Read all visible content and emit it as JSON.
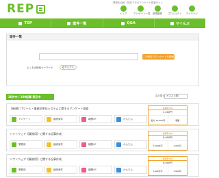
{
  "header": {
    "logo": "REP",
    "tagline": "業務を比較・検討できるアンケート調査サイト",
    "icons": [
      {
        "name": "home-icon",
        "label": "トップ"
      },
      {
        "name": "list-icon",
        "label": "アンケート一覧"
      },
      {
        "name": "pen-icon",
        "label": "新規登録"
      },
      {
        "name": "doc-icon",
        "label": "プロジェクト"
      },
      {
        "name": "user-icon",
        "label": "マイページ"
      }
    ]
  },
  "nav": {
    "items": [
      {
        "label": "TOP",
        "icon": "home-icon"
      },
      {
        "label": "案件一覧",
        "icon": "list-icon"
      },
      {
        "label": "Q&A",
        "icon": "qa-icon"
      },
      {
        "label": "マイんぷ",
        "icon": "user-icon"
      }
    ]
  },
  "search": {
    "heading": "案件一覧",
    "button_label": "この条件でアンケートを検索",
    "keyword_label": "よくある検索キーワード",
    "keyword_tag": "かんたん"
  },
  "results": {
    "count_label": "26件中 / 100記事 表示中",
    "sort_label": "並び替え",
    "sort_value": "オススメ順"
  },
  "cards": [
    {
      "title": "【新規】ITツール・業務効率化システムに関するアンケート調査",
      "pills": [
        "アンケート",
        "継続案件",
        "報酬UP",
        "かんたん"
      ],
      "offer_header": "依頼受付中",
      "offer_line": "2,000円",
      "offer_left": "最大 10,000円",
      "offer_right": "報酬"
    },
    {
      "title": "ソフトウェア【業務用】に関する記事作成",
      "pills": [
        "業務用",
        "継続案件",
        "報酬UP",
        "かんたん"
      ],
      "offer_header": "依頼受付中",
      "offer_line": "8,000円",
      "offer_left": "1000文字",
      "offer_right": "3,000円"
    },
    {
      "title": "ソフトウェア【業務用】に関する記事作成",
      "pills": [
        "業務用",
        "継続案件",
        "報酬UP",
        "かんたん"
      ],
      "offer_header": "依頼受付中",
      "offer_line": "8,000円",
      "offer_left": "1000文字",
      "offer_right": "3,000円"
    }
  ],
  "colors": {
    "brand": "#6bbf2a",
    "accent": "#f2a22c"
  }
}
